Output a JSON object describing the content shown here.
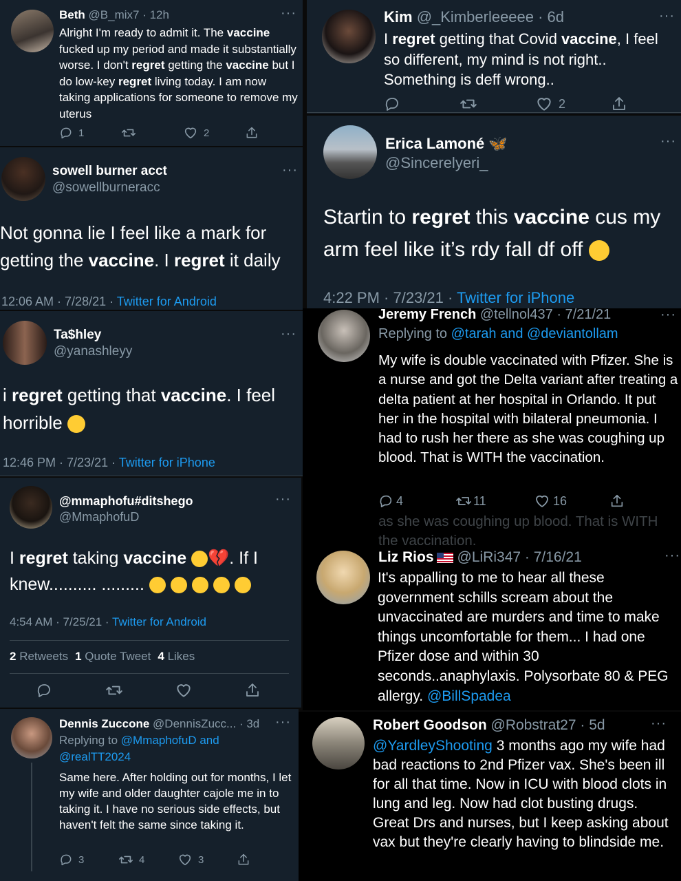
{
  "colors": {
    "link": "#1d9bf0",
    "dim_bg": "#15202b",
    "muted": "#8899a6"
  },
  "beth": {
    "name": "Beth",
    "handle": "@B_mix7",
    "time": "· 12h",
    "text": [
      "Alright I'm ready to admit it. The ",
      "vaccine",
      " fucked up my period and made it substantially worse. I don't ",
      "regret",
      " getting the ",
      "vaccine",
      " but I do low-key ",
      "regret",
      " living today. I am now taking applications for someone to remove my uterus"
    ],
    "replies": "1",
    "retweets": "",
    "likes": "2"
  },
  "kim": {
    "name": "Kim",
    "handle": "@_Kimberleeeee · 6d",
    "text": [
      "I ",
      "regret",
      " getting that Covid ",
      "vaccine",
      ", I feel so different, my mind is not right.. Something is deff wrong.."
    ],
    "likes": "2"
  },
  "sowell": {
    "name": "sowell burner acct",
    "handle": "@sowellburneracc",
    "text": [
      "Not gonna lie I feel like a mark for getting the ",
      "vaccine",
      ". I ",
      "regret",
      " it daily"
    ],
    "time": "12:06 AM · 7/28/21 · ",
    "source": "Twitter for Android"
  },
  "erica": {
    "name": "Erica Lamoné",
    "handle": "@Sincerelyeri_",
    "text": [
      "Startin to ",
      "regret",
      " this ",
      "vaccine",
      " cus my arm feel like it’s rdy fall df off"
    ],
    "time": "4:22 PM · 7/23/21 · ",
    "source": "Twitter for iPhone"
  },
  "tashley": {
    "name": "Ta$hley",
    "handle": "@yanashleyy",
    "text": [
      "i ",
      "regret",
      " getting that ",
      "vaccine",
      ". I feel horrible"
    ],
    "time": "12:46 PM · 7/23/21 · ",
    "source": "Twitter for iPhone"
  },
  "jeremy": {
    "name": "Jeremy French",
    "handle": "@tellnol437 · 7/21/21",
    "reply_prefix": "Replying to ",
    "reply_to": "@tarah and @deviantollam",
    "text": "My wife is double vaccinated with Pfizer. She is a nurse and got the Delta variant after treating a delta patient at her hospital in Orlando. It put her in the hospital with bilateral pneumonia. I had to rush her there as she was coughing up blood. That is WITH the vaccination.",
    "replies": "4",
    "retweets": "11",
    "likes": "16",
    "ghost": "as she was coughing up blood. That is WITH the vaccination."
  },
  "mmaphofu": {
    "name": "@mmaphofu#ditshego",
    "handle": "@MmaphofuD",
    "text": [
      "I ",
      "regret",
      " taking ",
      "vaccine",
      ". If I knew.......... ........."
    ],
    "time": "4:54 AM · 7/25/21 · ",
    "source": "Twitter for Android",
    "stats": [
      {
        "n": "2",
        "label": "Retweets"
      },
      {
        "n": "1",
        "label": "Quote Tweet"
      },
      {
        "n": "4",
        "label": "Likes"
      }
    ]
  },
  "liz": {
    "name": "Liz Rios",
    "handle": "@LiRi347 · 7/16/21",
    "text": "It's appalling to me to hear all these government schills scream about the unvaccinated are murders and time to make things uncomfortable for them... I had one Pfizer dose and within 30 seconds..anaphylaxis. Polysorbate 80 & PEG allergy. ",
    "mention": "@BillSpadea"
  },
  "dennis": {
    "name": "Dennis Zuccone",
    "handle": "@DennisZucc... · 3d",
    "reply_prefix": "Replying to ",
    "reply_to": "@MmaphofuD and @realTT2024",
    "text": "Same here. After holding out for months, I let my wife and older daughter cajole me in to taking it. I have no serious side effects, but haven't felt the same since taking it.",
    "replies": "3",
    "retweets": "4",
    "likes": "3"
  },
  "robert": {
    "name": "Robert Goodson",
    "handle": "@Robstrat27 · 5d",
    "mention": "@YardleyShooting",
    "text": " 3 months ago my wife had bad reactions to 2nd Pfizer vax. She's been ill for all that time. Now in ICU with blood clots in lung and leg. Now had clot busting drugs. Great Drs and nurses, but I keep asking about vax but they're clearly having to blindside me."
  }
}
